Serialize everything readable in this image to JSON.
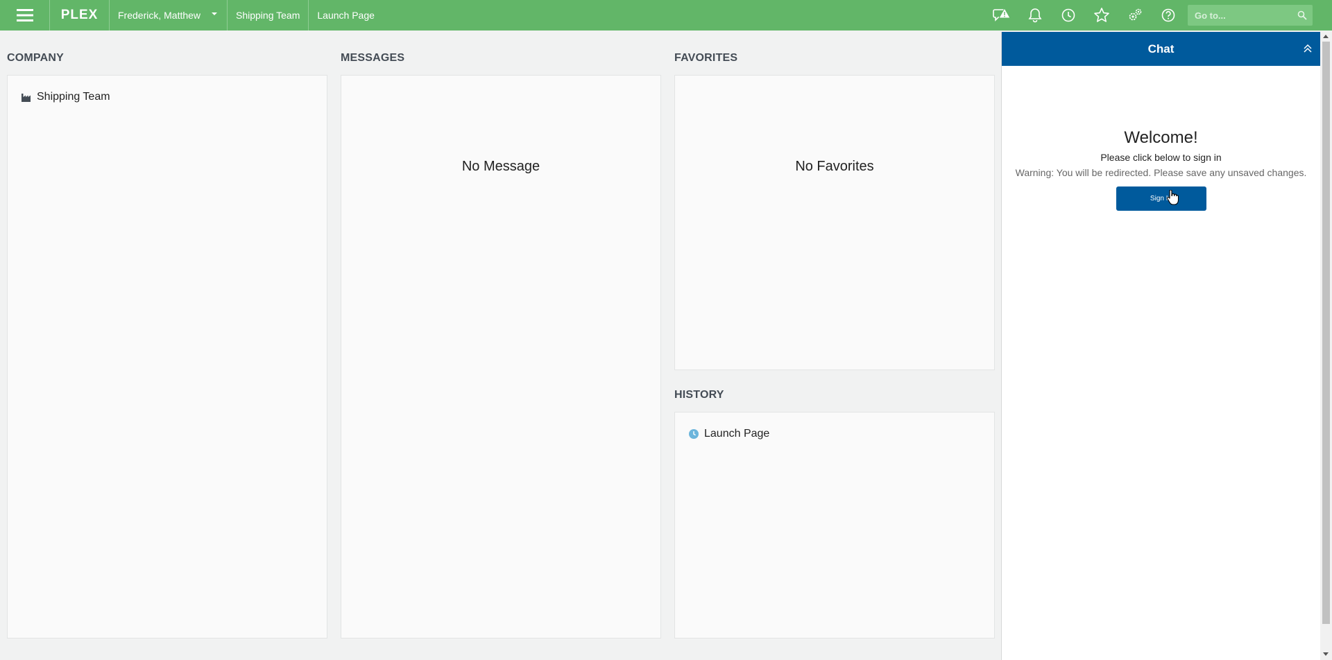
{
  "topbar": {
    "logo": "PLEX",
    "user": "Frederick, Matthew",
    "crumbs": [
      "Shipping Team",
      "Launch Page"
    ],
    "search_placeholder": "Go to...",
    "icons": [
      "alert-icon",
      "bell-icon",
      "clock-icon",
      "star-icon",
      "gears-icon",
      "help-icon"
    ]
  },
  "company": {
    "title": "COMPANY",
    "items": [
      "Shipping Team"
    ]
  },
  "messages": {
    "title": "MESSAGES",
    "empty": "No Message"
  },
  "favorites": {
    "title": "FAVORITES",
    "empty": "No Favorites"
  },
  "history": {
    "title": "HISTORY",
    "items": [
      "Launch Page"
    ]
  },
  "chat": {
    "title": "Chat",
    "welcome": "Welcome!",
    "instruction": "Please click below to sign in",
    "warning": "Warning: You will be redirected. Please save any unsaved changes.",
    "button": "Sign In"
  },
  "colors": {
    "topbar": "#62b668",
    "chat_header": "#005a9c",
    "accent_blue": "#005a9c",
    "clock_icon": "#6cb5dc"
  }
}
